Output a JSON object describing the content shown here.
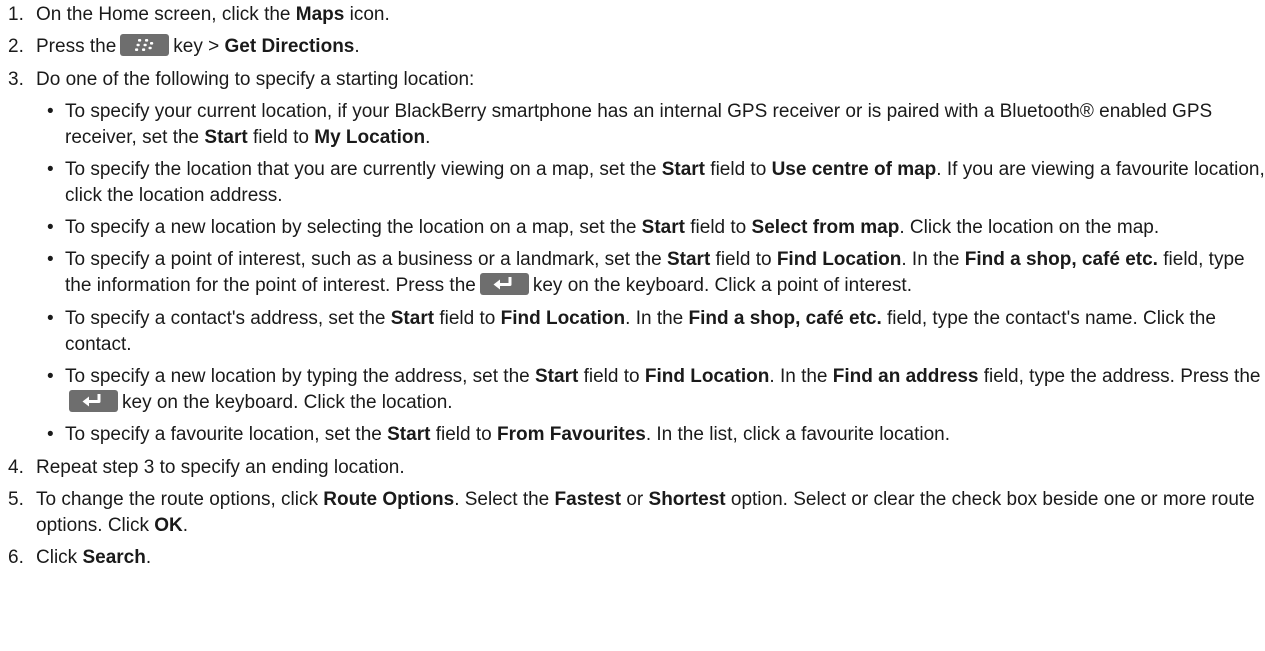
{
  "steps": [
    {
      "num": "1.",
      "p1": "On the Home screen, click the ",
      "b1": "Maps",
      "p2": " icon."
    },
    {
      "num": "2.",
      "p1": "Press the",
      "p2": "key > ",
      "b1": "Get Directions",
      "p3": ".",
      "key_icon": "blackberry-menu-key-icon"
    },
    {
      "num": "3.",
      "text": "Do one of the following to specify a starting location:",
      "bullets": [
        {
          "p1": "To specify your current location, if your BlackBerry smartphone has an internal GPS receiver or is paired with a Bluetooth® enabled GPS receiver, set the ",
          "b1": "Start",
          "p2": " field to ",
          "b2": "My Location",
          "p3": "."
        },
        {
          "p1": "To specify the location that you are currently viewing on a map, set the ",
          "b1": "Start",
          "p2": " field to ",
          "b2": "Use centre of map",
          "p3": ". If you are viewing a favourite location, click the location address."
        },
        {
          "p1": "To specify a new location by selecting the location on a map, set the ",
          "b1": "Start",
          "p2": " field to ",
          "b2": "Select from map",
          "p3": ". Click the location on the map."
        },
        {
          "p1": "To specify a point of interest, such as a business or a landmark, set the ",
          "b1": "Start",
          "p2": " field to ",
          "b2": "Find Location",
          "p3": ". In the ",
          "b3": "Find a shop, café etc.",
          "p4": " field, type the information for the point of interest. Press the",
          "p5": "key on the keyboard. Click a point of interest.",
          "key_icon": "enter-key-icon"
        },
        {
          "p1": "To specify a contact's address, set the ",
          "b1": "Start",
          "p2": " field to ",
          "b2": "Find Location",
          "p3": ". In the ",
          "b3": "Find a shop, café etc.",
          "p4": " field, type the contact's name. Click the contact."
        },
        {
          "p1": "To specify a new location by typing the address, set the ",
          "b1": "Start",
          "p2": " field to ",
          "b2": "Find Location",
          "p3": ". In the ",
          "b3": "Find an address",
          "p4": " field, type the address. Press the",
          "p5": "key on the keyboard. Click the location.",
          "key_icon": "enter-key-icon"
        },
        {
          "p1": "To specify a favourite location, set the ",
          "b1": "Start",
          "p2": " field to ",
          "b2": "From Favourites",
          "p3": ". In the list, click a favourite location."
        }
      ]
    },
    {
      "num": "4.",
      "text": "Repeat step 3 to specify an ending location."
    },
    {
      "num": "5.",
      "p1": "To change the route options, click ",
      "b1": "Route Options",
      "p2": ". Select the ",
      "b2": "Fastest",
      "p3": " or ",
      "b3": "Shortest",
      "p4": " option. Select or clear the check box beside one or more route options. Click ",
      "b4": "OK",
      "p5": "."
    },
    {
      "num": "6.",
      "p1": "Click ",
      "b1": "Search",
      "p2": "."
    }
  ],
  "colors": {
    "text": "#1a1a1a",
    "key_background": "#6e6e6e",
    "key_glyph": "#ffffff"
  }
}
